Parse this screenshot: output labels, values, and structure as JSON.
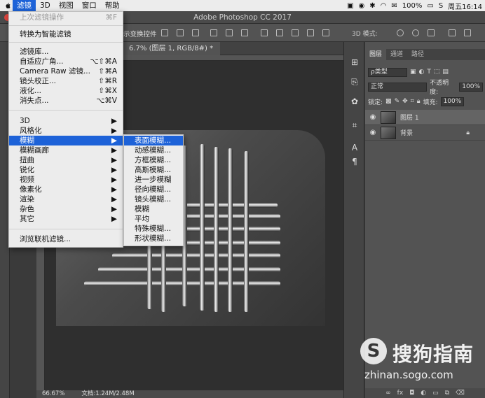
{
  "menubar": {
    "items": [
      {
        "label": "滤镜",
        "active": true
      },
      {
        "label": "3D"
      },
      {
        "label": "视图"
      },
      {
        "label": "窗口"
      },
      {
        "label": "帮助"
      }
    ],
    "battery": "100%",
    "clock": "周五16:14"
  },
  "window": {
    "title": "Adobe Photoshop CC 2017"
  },
  "options_bar": {
    "transform_label": "示变换控件",
    "mode_label": "3D 模式:"
  },
  "document": {
    "tab_label": "6.7% (图层 1, RGB/8#) *"
  },
  "status": {
    "zoom": "66.67%",
    "doc_size": "文档:1.24M/2.48M"
  },
  "filter_menu": {
    "items": [
      {
        "label": "上次滤镜操作",
        "shortcut": "⌘F",
        "disabled": true
      },
      {
        "label": "转换为智能滤镜"
      },
      {
        "label": "滤镜库..."
      },
      {
        "label": "自适应广角...",
        "shortcut": "⌥⇧⌘A"
      },
      {
        "label": "Camera Raw 滤镜...",
        "shortcut": "⇧⌘A"
      },
      {
        "label": "镜头校正...",
        "shortcut": "⇧⌘R"
      },
      {
        "label": "液化...",
        "shortcut": "⇧⌘X"
      },
      {
        "label": "消失点...",
        "shortcut": "⌥⌘V"
      },
      {
        "label": "3D",
        "shortcut": "▶"
      },
      {
        "label": "风格化",
        "shortcut": "▶"
      },
      {
        "label": "模糊",
        "shortcut": "▶",
        "highlighted": true
      },
      {
        "label": "模糊画廊",
        "shortcut": "▶"
      },
      {
        "label": "扭曲",
        "shortcut": "▶"
      },
      {
        "label": "锐化",
        "shortcut": "▶"
      },
      {
        "label": "视频",
        "shortcut": "▶"
      },
      {
        "label": "像素化",
        "shortcut": "▶"
      },
      {
        "label": "渲染",
        "shortcut": "▶"
      },
      {
        "label": "杂色",
        "shortcut": "▶"
      },
      {
        "label": "其它",
        "shortcut": "▶"
      },
      {
        "label": "浏览联机滤镜..."
      }
    ]
  },
  "blur_submenu": {
    "items": [
      {
        "label": "表面模糊...",
        "highlighted": true
      },
      {
        "label": "动感模糊..."
      },
      {
        "label": "方框模糊..."
      },
      {
        "label": "高斯模糊..."
      },
      {
        "label": "进一步模糊"
      },
      {
        "label": "径向模糊..."
      },
      {
        "label": "镜头模糊..."
      },
      {
        "label": "模糊"
      },
      {
        "label": "平均"
      },
      {
        "label": "特殊模糊..."
      },
      {
        "label": "形状模糊..."
      }
    ]
  },
  "layers_panel": {
    "tabs": [
      "图层",
      "通道",
      "路径"
    ],
    "filter_kind": "ρ类型",
    "blend_mode": "正常",
    "opacity_label": "不透明度:",
    "opacity_value": "100%",
    "lock_label": "锁定:",
    "fill_label": "填充:",
    "fill_value": "100%",
    "layers": [
      {
        "name": "图层 1"
      },
      {
        "name": "背景"
      }
    ],
    "footer_icons": [
      "link-icon",
      "fx",
      "mask-icon",
      "adjustment-icon",
      "folder-icon",
      "new-layer-icon",
      "trash-icon"
    ]
  },
  "watermark": {
    "brand": "搜狗指南",
    "url": "zhinan.sogo.com"
  }
}
